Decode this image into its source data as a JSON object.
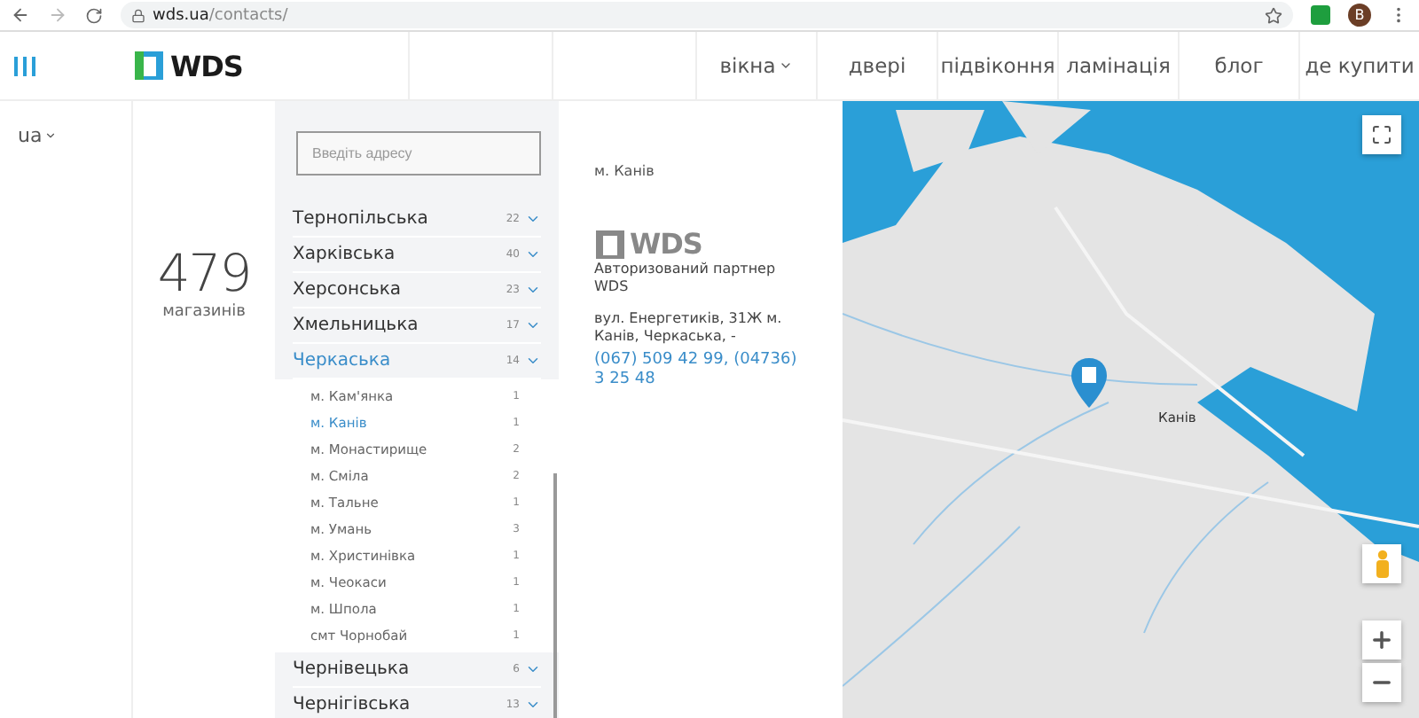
{
  "browser": {
    "url_host": "wds.ua",
    "url_path": "/contacts/",
    "profile_initial": "B"
  },
  "header": {
    "logo": "WDS",
    "nav": [
      {
        "label": "вікна",
        "dropdown": true
      },
      {
        "label": "двері",
        "dropdown": false
      },
      {
        "label": "підвіконня",
        "dropdown": false
      },
      {
        "label": "ламінація",
        "dropdown": false
      },
      {
        "label": "блог",
        "dropdown": false
      },
      {
        "label": "де купити",
        "dropdown": false
      }
    ]
  },
  "language": "ua",
  "counter": {
    "value": "479",
    "label": "магазинів"
  },
  "search": {
    "placeholder": "Введіть адресу"
  },
  "regions": [
    {
      "name": "Тернопільська",
      "count": "22",
      "expanded": false
    },
    {
      "name": "Харківська",
      "count": "40",
      "expanded": false
    },
    {
      "name": "Херсонська",
      "count": "23",
      "expanded": false
    },
    {
      "name": "Хмельницька",
      "count": "17",
      "expanded": false
    },
    {
      "name": "Черкаська",
      "count": "14",
      "expanded": true,
      "children": [
        {
          "name": "м. Кам'янка",
          "count": "1",
          "selected": false
        },
        {
          "name": "м. Канів",
          "count": "1",
          "selected": true
        },
        {
          "name": "м. Монастирище",
          "count": "2",
          "selected": false
        },
        {
          "name": "м. Сміла",
          "count": "2",
          "selected": false
        },
        {
          "name": "м. Тальне",
          "count": "1",
          "selected": false
        },
        {
          "name": "м. Умань",
          "count": "3",
          "selected": false
        },
        {
          "name": "м. Христинівка",
          "count": "1",
          "selected": false
        },
        {
          "name": "м. Чеокаси",
          "count": "1",
          "selected": false
        },
        {
          "name": "м. Шпола",
          "count": "1",
          "selected": false
        },
        {
          "name": "смт Чорнобай",
          "count": "1",
          "selected": false
        }
      ]
    },
    {
      "name": "Чернівецька",
      "count": "6",
      "expanded": false
    },
    {
      "name": "Чернігівська",
      "count": "13",
      "expanded": false
    }
  ],
  "store": {
    "city": "м. Канів",
    "logo": "WDS",
    "partner": "Авторизований партнер WDS",
    "address": "вул. Енергетиків, 31Ж м. Канів, Черкаська, -",
    "phones": "(067) 509 42 99,  (04736) 3 25 48"
  },
  "map": {
    "place_label": "Канів"
  }
}
